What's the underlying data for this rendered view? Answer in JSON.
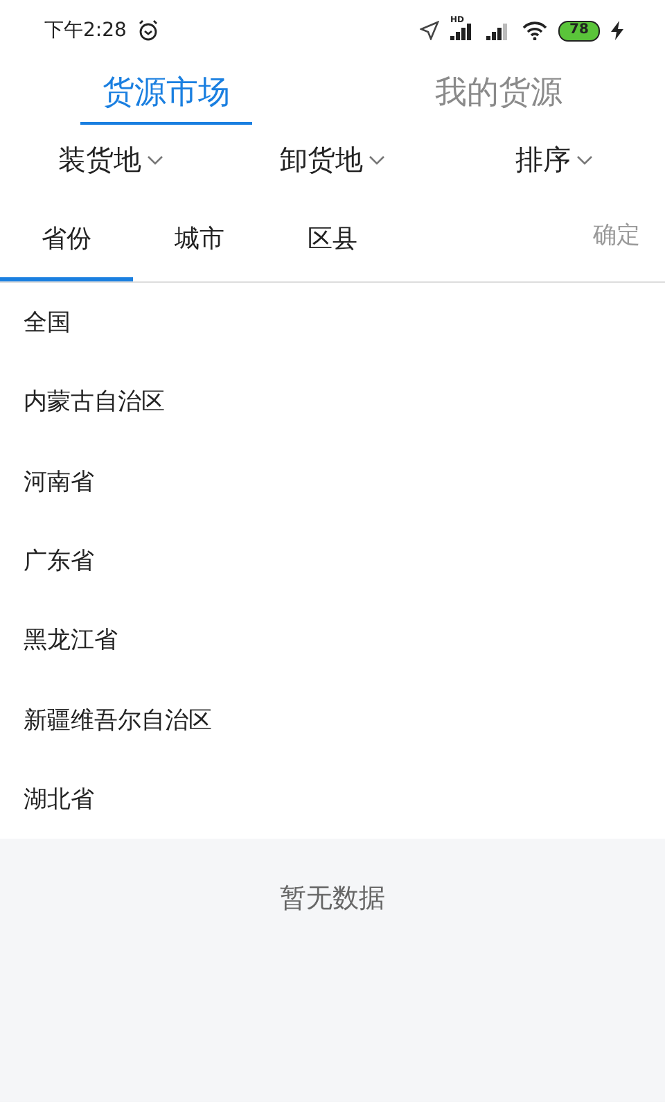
{
  "status_bar": {
    "time": "下午2:28",
    "signal_label": "HD",
    "battery": "78"
  },
  "tabs": [
    {
      "label": "货源市场",
      "selected": true
    },
    {
      "label": "我的货源",
      "selected": false
    }
  ],
  "filters": [
    {
      "label": "装货地"
    },
    {
      "label": "卸货地"
    },
    {
      "label": "排序"
    }
  ],
  "region_tabs": [
    {
      "label": "省份",
      "selected": true
    },
    {
      "label": "城市",
      "selected": false
    },
    {
      "label": "区县",
      "selected": false
    }
  ],
  "confirm": "确定",
  "regions": [
    "全国",
    "内蒙古自治区",
    "河南省",
    "广东省",
    "黑龙江省",
    "新疆维吾尔自治区",
    "湖北省"
  ],
  "empty_text": "暂无数据"
}
